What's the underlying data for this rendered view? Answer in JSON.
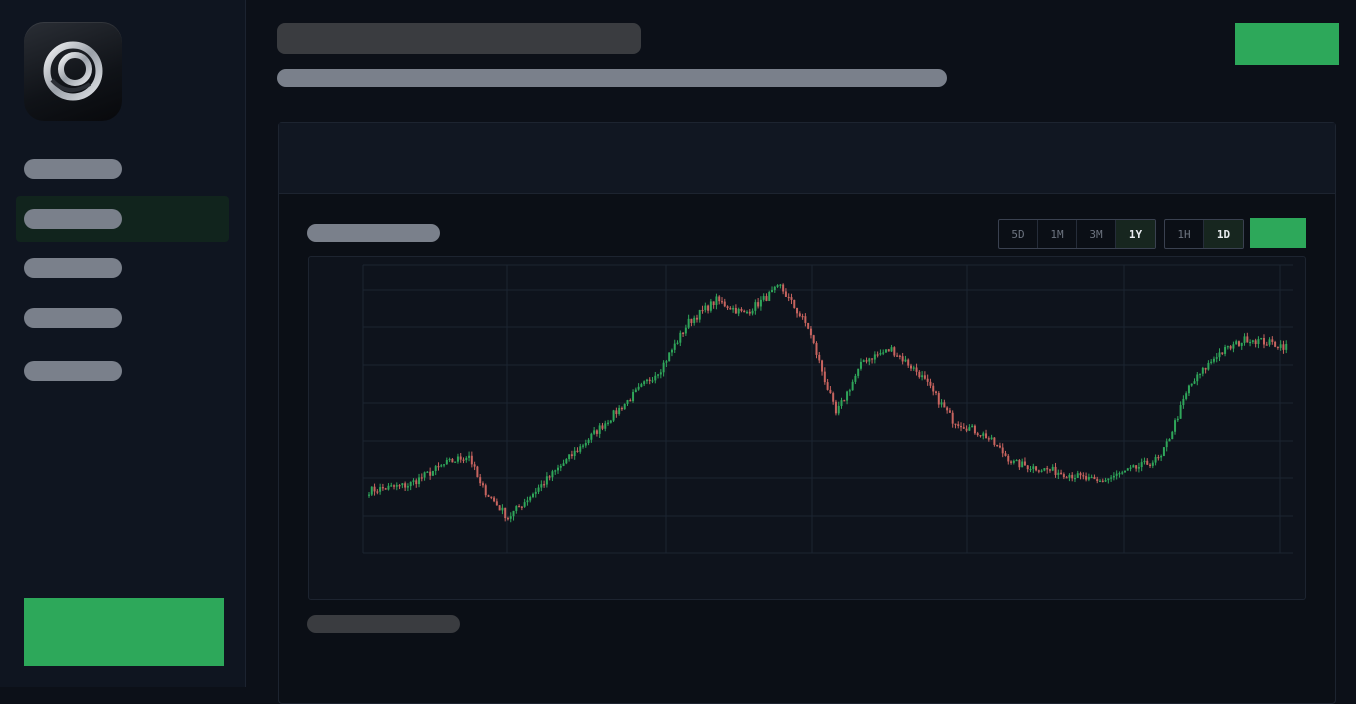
{
  "sidebar": {
    "logo_icon": "ring-logo-icon",
    "items": [
      {
        "active": false
      },
      {
        "active": true
      },
      {
        "active": false
      },
      {
        "active": false
      },
      {
        "active": false
      }
    ]
  },
  "chart_controls": {
    "ranges": [
      "5D",
      "1M",
      "3M",
      "1Y"
    ],
    "selected_range": "1Y",
    "intervals": [
      "1H",
      "1D"
    ],
    "selected_interval": "1D"
  },
  "colors": {
    "accent": "#2da85a",
    "up": "#2fa65a",
    "down": "#c8645f",
    "grid": "#1c2431"
  },
  "chart_data": {
    "type": "candlestick",
    "grid": true,
    "x": {
      "count": 250
    },
    "ylim": [
      -3,
      103
    ],
    "anchors": [
      [
        0,
        20
      ],
      [
        14,
        22
      ],
      [
        28,
        30
      ],
      [
        36,
        33
      ],
      [
        40,
        22
      ],
      [
        50,
        10
      ],
      [
        60,
        20
      ],
      [
        70,
        30
      ],
      [
        80,
        40
      ],
      [
        95,
        55
      ],
      [
        105,
        65
      ],
      [
        115,
        82
      ],
      [
        125,
        90
      ],
      [
        135,
        85
      ],
      [
        148,
        95
      ],
      [
        158,
        80
      ],
      [
        168,
        48
      ],
      [
        178,
        68
      ],
      [
        188,
        72
      ],
      [
        198,
        63
      ],
      [
        210,
        46
      ],
      [
        222,
        40
      ],
      [
        232,
        30
      ],
      [
        242,
        28
      ],
      [
        252,
        26
      ],
      [
        262,
        23
      ],
      [
        273,
        27
      ],
      [
        285,
        32
      ],
      [
        295,
        58
      ],
      [
        305,
        70
      ],
      [
        316,
        76
      ],
      [
        330,
        73
      ]
    ]
  }
}
